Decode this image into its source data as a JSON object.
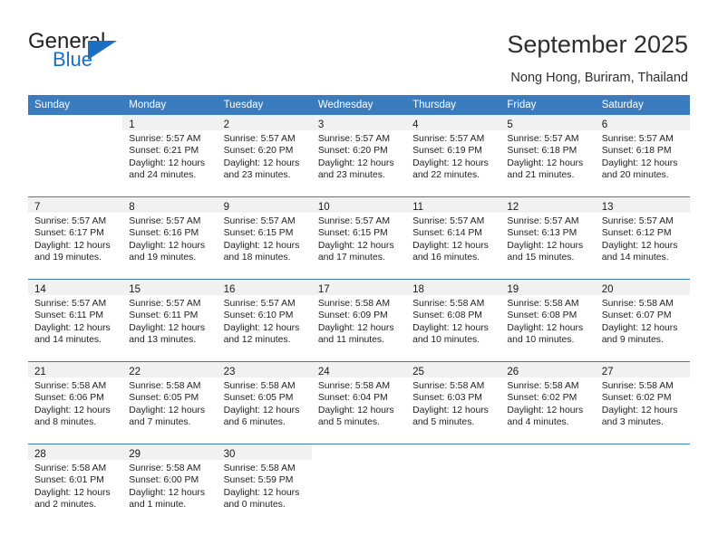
{
  "brand": {
    "name_part1": "General",
    "name_part2": "Blue",
    "accent_color": "#1b6ec2",
    "triangle_icon": "triangle-icon"
  },
  "header": {
    "title": "September 2025",
    "subtitle": "Nong Hong, Buriram, Thailand"
  },
  "calendar": {
    "header_bg": "#3b7cbf",
    "daynum_bg": "#f1f1f1",
    "weekdays": [
      "Sunday",
      "Monday",
      "Tuesday",
      "Wednesday",
      "Thursday",
      "Friday",
      "Saturday"
    ],
    "labels": {
      "sunrise": "Sunrise:",
      "sunset": "Sunset:",
      "daylight": "Daylight:"
    },
    "weeks": [
      [
        {
          "day": "",
          "l1": "",
          "l2": "",
          "l3": "",
          "l4": ""
        },
        {
          "day": "1",
          "l1": "Sunrise: 5:57 AM",
          "l2": "Sunset: 6:21 PM",
          "l3": "Daylight: 12 hours",
          "l4": "and 24 minutes."
        },
        {
          "day": "2",
          "l1": "Sunrise: 5:57 AM",
          "l2": "Sunset: 6:20 PM",
          "l3": "Daylight: 12 hours",
          "l4": "and 23 minutes."
        },
        {
          "day": "3",
          "l1": "Sunrise: 5:57 AM",
          "l2": "Sunset: 6:20 PM",
          "l3": "Daylight: 12 hours",
          "l4": "and 23 minutes."
        },
        {
          "day": "4",
          "l1": "Sunrise: 5:57 AM",
          "l2": "Sunset: 6:19 PM",
          "l3": "Daylight: 12 hours",
          "l4": "and 22 minutes."
        },
        {
          "day": "5",
          "l1": "Sunrise: 5:57 AM",
          "l2": "Sunset: 6:18 PM",
          "l3": "Daylight: 12 hours",
          "l4": "and 21 minutes."
        },
        {
          "day": "6",
          "l1": "Sunrise: 5:57 AM",
          "l2": "Sunset: 6:18 PM",
          "l3": "Daylight: 12 hours",
          "l4": "and 20 minutes."
        }
      ],
      [
        {
          "day": "7",
          "l1": "Sunrise: 5:57 AM",
          "l2": "Sunset: 6:17 PM",
          "l3": "Daylight: 12 hours",
          "l4": "and 19 minutes."
        },
        {
          "day": "8",
          "l1": "Sunrise: 5:57 AM",
          "l2": "Sunset: 6:16 PM",
          "l3": "Daylight: 12 hours",
          "l4": "and 19 minutes."
        },
        {
          "day": "9",
          "l1": "Sunrise: 5:57 AM",
          "l2": "Sunset: 6:15 PM",
          "l3": "Daylight: 12 hours",
          "l4": "and 18 minutes."
        },
        {
          "day": "10",
          "l1": "Sunrise: 5:57 AM",
          "l2": "Sunset: 6:15 PM",
          "l3": "Daylight: 12 hours",
          "l4": "and 17 minutes."
        },
        {
          "day": "11",
          "l1": "Sunrise: 5:57 AM",
          "l2": "Sunset: 6:14 PM",
          "l3": "Daylight: 12 hours",
          "l4": "and 16 minutes."
        },
        {
          "day": "12",
          "l1": "Sunrise: 5:57 AM",
          "l2": "Sunset: 6:13 PM",
          "l3": "Daylight: 12 hours",
          "l4": "and 15 minutes."
        },
        {
          "day": "13",
          "l1": "Sunrise: 5:57 AM",
          "l2": "Sunset: 6:12 PM",
          "l3": "Daylight: 12 hours",
          "l4": "and 14 minutes."
        }
      ],
      [
        {
          "day": "14",
          "l1": "Sunrise: 5:57 AM",
          "l2": "Sunset: 6:11 PM",
          "l3": "Daylight: 12 hours",
          "l4": "and 14 minutes."
        },
        {
          "day": "15",
          "l1": "Sunrise: 5:57 AM",
          "l2": "Sunset: 6:11 PM",
          "l3": "Daylight: 12 hours",
          "l4": "and 13 minutes."
        },
        {
          "day": "16",
          "l1": "Sunrise: 5:57 AM",
          "l2": "Sunset: 6:10 PM",
          "l3": "Daylight: 12 hours",
          "l4": "and 12 minutes."
        },
        {
          "day": "17",
          "l1": "Sunrise: 5:58 AM",
          "l2": "Sunset: 6:09 PM",
          "l3": "Daylight: 12 hours",
          "l4": "and 11 minutes."
        },
        {
          "day": "18",
          "l1": "Sunrise: 5:58 AM",
          "l2": "Sunset: 6:08 PM",
          "l3": "Daylight: 12 hours",
          "l4": "and 10 minutes."
        },
        {
          "day": "19",
          "l1": "Sunrise: 5:58 AM",
          "l2": "Sunset: 6:08 PM",
          "l3": "Daylight: 12 hours",
          "l4": "and 10 minutes."
        },
        {
          "day": "20",
          "l1": "Sunrise: 5:58 AM",
          "l2": "Sunset: 6:07 PM",
          "l3": "Daylight: 12 hours",
          "l4": "and 9 minutes."
        }
      ],
      [
        {
          "day": "21",
          "l1": "Sunrise: 5:58 AM",
          "l2": "Sunset: 6:06 PM",
          "l3": "Daylight: 12 hours",
          "l4": "and 8 minutes."
        },
        {
          "day": "22",
          "l1": "Sunrise: 5:58 AM",
          "l2": "Sunset: 6:05 PM",
          "l3": "Daylight: 12 hours",
          "l4": "and 7 minutes."
        },
        {
          "day": "23",
          "l1": "Sunrise: 5:58 AM",
          "l2": "Sunset: 6:05 PM",
          "l3": "Daylight: 12 hours",
          "l4": "and 6 minutes."
        },
        {
          "day": "24",
          "l1": "Sunrise: 5:58 AM",
          "l2": "Sunset: 6:04 PM",
          "l3": "Daylight: 12 hours",
          "l4": "and 5 minutes."
        },
        {
          "day": "25",
          "l1": "Sunrise: 5:58 AM",
          "l2": "Sunset: 6:03 PM",
          "l3": "Daylight: 12 hours",
          "l4": "and 5 minutes."
        },
        {
          "day": "26",
          "l1": "Sunrise: 5:58 AM",
          "l2": "Sunset: 6:02 PM",
          "l3": "Daylight: 12 hours",
          "l4": "and 4 minutes."
        },
        {
          "day": "27",
          "l1": "Sunrise: 5:58 AM",
          "l2": "Sunset: 6:02 PM",
          "l3": "Daylight: 12 hours",
          "l4": "and 3 minutes."
        }
      ],
      [
        {
          "day": "28",
          "l1": "Sunrise: 5:58 AM",
          "l2": "Sunset: 6:01 PM",
          "l3": "Daylight: 12 hours",
          "l4": "and 2 minutes."
        },
        {
          "day": "29",
          "l1": "Sunrise: 5:58 AM",
          "l2": "Sunset: 6:00 PM",
          "l3": "Daylight: 12 hours",
          "l4": "and 1 minute."
        },
        {
          "day": "30",
          "l1": "Sunrise: 5:58 AM",
          "l2": "Sunset: 5:59 PM",
          "l3": "Daylight: 12 hours",
          "l4": "and 0 minutes."
        },
        {
          "day": "",
          "l1": "",
          "l2": "",
          "l3": "",
          "l4": ""
        },
        {
          "day": "",
          "l1": "",
          "l2": "",
          "l3": "",
          "l4": ""
        },
        {
          "day": "",
          "l1": "",
          "l2": "",
          "l3": "",
          "l4": ""
        },
        {
          "day": "",
          "l1": "",
          "l2": "",
          "l3": "",
          "l4": ""
        }
      ]
    ]
  }
}
